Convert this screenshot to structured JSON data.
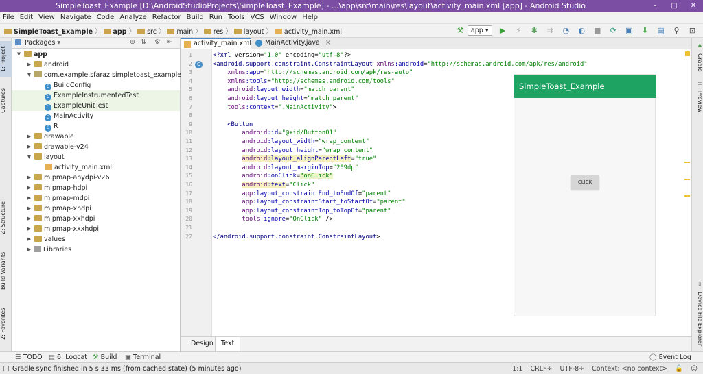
{
  "window": {
    "title": "SimpleToast_Example [D:\\AndroidStudioProjects\\SimpleToast_Example] - ...\\app\\src\\main\\res\\layout\\activity_main.xml [app] - Android Studio",
    "minimize": "–",
    "maximize": "□",
    "close": "✕"
  },
  "menu": [
    "File",
    "Edit",
    "View",
    "Navigate",
    "Code",
    "Analyze",
    "Refactor",
    "Build",
    "Run",
    "Tools",
    "VCS",
    "Window",
    "Help"
  ],
  "breadcrumb": [
    "SimpleToast_Example",
    "app",
    "src",
    "main",
    "res",
    "layout",
    "activity_main.xml"
  ],
  "toolbar": {
    "config": "app"
  },
  "left_tabs": {
    "project": "1: Project",
    "captures": "Captures",
    "structure": "Z: Structure",
    "build_variants": "Build Variants",
    "favorites": "2: Favorites"
  },
  "right_tabs": {
    "gradle": "Gradle",
    "preview": "Preview",
    "device_explorer": "Device File Explorer"
  },
  "project_panel": {
    "view": "Packages",
    "tree": [
      {
        "label": "app",
        "level": 0,
        "expanded": true,
        "icon": "folder-icon"
      },
      {
        "label": "android",
        "level": 1,
        "expanded": false,
        "icon": "folder-icon"
      },
      {
        "label": "com.example.sfaraz.simpletoast_example",
        "level": 1,
        "expanded": true,
        "icon": "package-icon"
      },
      {
        "label": "BuildConfig",
        "level": 2,
        "icon": "class-icon"
      },
      {
        "label": "ExampleInstrumentedTest",
        "level": 2,
        "icon": "class-icon",
        "highlight": true
      },
      {
        "label": "ExampleUnitTest",
        "level": 2,
        "icon": "class-icon",
        "highlight": true
      },
      {
        "label": "MainActivity",
        "level": 2,
        "icon": "class-icon"
      },
      {
        "label": "R",
        "level": 2,
        "icon": "class-icon"
      },
      {
        "label": "drawable",
        "level": 1,
        "expanded": false,
        "icon": "folder-icon"
      },
      {
        "label": "drawable-v24",
        "level": 1,
        "expanded": false,
        "icon": "folder-icon"
      },
      {
        "label": "layout",
        "level": 1,
        "expanded": true,
        "icon": "folder-icon"
      },
      {
        "label": "activity_main.xml",
        "level": 2,
        "icon": "xml-icon"
      },
      {
        "label": "mipmap-anydpi-v26",
        "level": 1,
        "expanded": false,
        "icon": "folder-icon"
      },
      {
        "label": "mipmap-hdpi",
        "level": 1,
        "expanded": false,
        "icon": "folder-icon"
      },
      {
        "label": "mipmap-mdpi",
        "level": 1,
        "expanded": false,
        "icon": "folder-icon"
      },
      {
        "label": "mipmap-xhdpi",
        "level": 1,
        "expanded": false,
        "icon": "folder-icon"
      },
      {
        "label": "mipmap-xxhdpi",
        "level": 1,
        "expanded": false,
        "icon": "folder-icon"
      },
      {
        "label": "mipmap-xxxhdpi",
        "level": 1,
        "expanded": false,
        "icon": "folder-icon"
      },
      {
        "label": "values",
        "level": 1,
        "expanded": false,
        "icon": "folder-icon"
      },
      {
        "label": "Libraries",
        "level": 1,
        "expanded": false,
        "icon": "library-icon"
      }
    ]
  },
  "editor_tabs": [
    {
      "label": "activity_main.xml",
      "active": true
    },
    {
      "label": "MainActivity.java",
      "active": false
    }
  ],
  "code_lines": [
    "<?xml version=\"1.0\" encoding=\"utf-8\"?>",
    "<android.support.constraint.ConstraintLayout xmlns:android=\"http://schemas.android.com/apk/res/android\"",
    "    xmlns:app=\"http://schemas.android.com/apk/res-auto\"",
    "    xmlns:tools=\"http://schemas.android.com/tools\"",
    "    android:layout_width=\"match_parent\"",
    "    android:layout_height=\"match_parent\"",
    "    tools:context=\".MainActivity\">",
    "",
    "    <Button",
    "        android:id=\"@+id/Button01\"",
    "        android:layout_width=\"wrap_content\"",
    "        android:layout_height=\"wrap_content\"",
    "        android:layout_alignParentLeft=\"true\"",
    "        android:layout_marginTop=\"209dp\"",
    "        android:onClick=\"onClick\"",
    "        android:text=\"Click\"",
    "        app:layout_constraintEnd_toEndOf=\"parent\"",
    "        app:layout_constraintStart_toStartOf=\"parent\"",
    "        app:layout_constraintTop_toTopOf=\"parent\"",
    "        tools:ignore=\"OnClick\" />",
    "",
    "</android.support.constraint.ConstraintLayout>"
  ],
  "preview": {
    "app_title": "SimpleToast_Example",
    "button_text": "CLICK"
  },
  "bottom_tabs": [
    {
      "label": "Design",
      "active": false
    },
    {
      "label": "Text",
      "active": true
    }
  ],
  "tool_windows": [
    "TODO",
    "6: Logcat",
    "Build",
    "Terminal"
  ],
  "event_log": "Event Log",
  "status": {
    "message": "Gradle sync finished in 5 s 33 ms (from cached state) (5 minutes ago)",
    "position": "1:1",
    "line_sep": "CRLF÷",
    "encoding": "UTF-8÷",
    "context": "Context: <no context>"
  },
  "colors": {
    "title_bar": "#7b4da3",
    "app_bar": "#1ea362",
    "selection": "#c9d6e6"
  }
}
